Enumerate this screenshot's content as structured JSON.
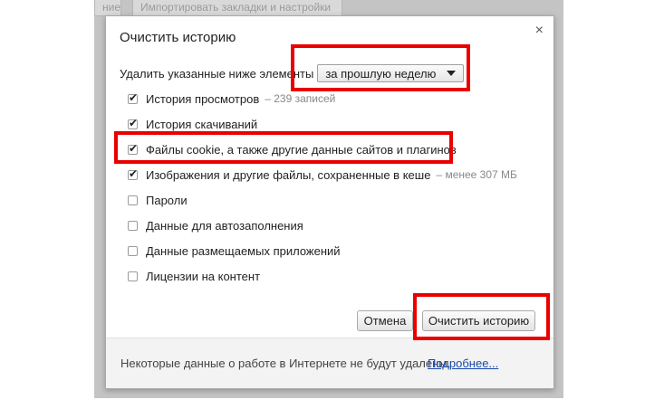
{
  "background": {
    "tab1_label": "ние",
    "tab2_label": "Импортировать закладки и настройки"
  },
  "dialog": {
    "title": "Очистить историю",
    "close_glyph": "×",
    "period_label": "Удалить указанные ниже элементы",
    "period_selected": "за прошлую неделю",
    "items": [
      {
        "label": "История просмотров",
        "note": "– 239 записей",
        "checked": true
      },
      {
        "label": "История скачиваний",
        "note": "",
        "checked": true
      },
      {
        "label": "Файлы cookie, а также другие данные сайтов и плагинов",
        "note": "",
        "checked": true
      },
      {
        "label": "Изображения и другие файлы, сохраненные в кеше",
        "note": "– менее 307 МБ",
        "checked": true
      },
      {
        "label": "Пароли",
        "note": "",
        "checked": false
      },
      {
        "label": "Данные для автозаполнения",
        "note": "",
        "checked": false
      },
      {
        "label": "Данные размещаемых приложений",
        "note": "",
        "checked": false
      },
      {
        "label": "Лицензии на контент",
        "note": "",
        "checked": false
      }
    ],
    "cancel_label": "Отмена",
    "clear_label": "Очистить историю",
    "footer_text": "Некоторые данные о работе в Интернете не будут удалены.",
    "footer_link": "Подробнее..."
  },
  "colors": {
    "highlight": "#ea0000",
    "link": "#1a4aa8"
  }
}
